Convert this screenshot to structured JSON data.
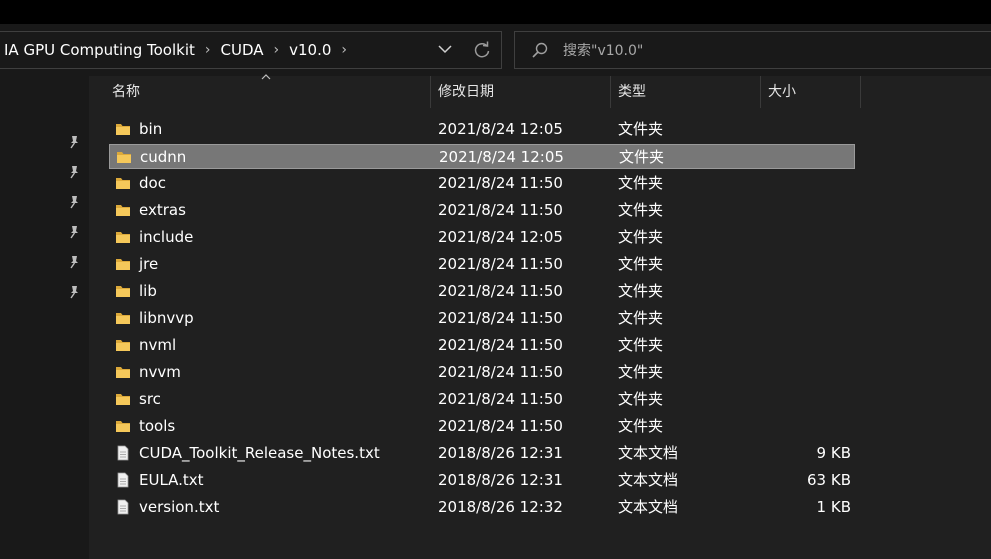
{
  "address_bar": {
    "breadcrumbs": [
      "IA GPU Computing Toolkit",
      "CUDA",
      "v10.0"
    ]
  },
  "search": {
    "placeholder": "搜索\"v10.0\""
  },
  "columns": {
    "name": "名称",
    "date": "修改日期",
    "type": "类型",
    "size": "大小"
  },
  "files": [
    {
      "name": "bin",
      "date": "2021/8/24 12:05",
      "type": "文件夹",
      "size": "",
      "icon": "folder-icon"
    },
    {
      "name": "cudnn",
      "date": "2021/8/24 12:05",
      "type": "文件夹",
      "size": "",
      "icon": "folder-icon",
      "selected": true
    },
    {
      "name": "doc",
      "date": "2021/8/24 11:50",
      "type": "文件夹",
      "size": "",
      "icon": "folder-icon"
    },
    {
      "name": "extras",
      "date": "2021/8/24 11:50",
      "type": "文件夹",
      "size": "",
      "icon": "folder-icon"
    },
    {
      "name": "include",
      "date": "2021/8/24 12:05",
      "type": "文件夹",
      "size": "",
      "icon": "folder-icon"
    },
    {
      "name": "jre",
      "date": "2021/8/24 11:50",
      "type": "文件夹",
      "size": "",
      "icon": "folder-icon"
    },
    {
      "name": "lib",
      "date": "2021/8/24 11:50",
      "type": "文件夹",
      "size": "",
      "icon": "folder-icon"
    },
    {
      "name": "libnvvp",
      "date": "2021/8/24 11:50",
      "type": "文件夹",
      "size": "",
      "icon": "folder-icon"
    },
    {
      "name": "nvml",
      "date": "2021/8/24 11:50",
      "type": "文件夹",
      "size": "",
      "icon": "folder-icon"
    },
    {
      "name": "nvvm",
      "date": "2021/8/24 11:50",
      "type": "文件夹",
      "size": "",
      "icon": "folder-icon"
    },
    {
      "name": "src",
      "date": "2021/8/24 11:50",
      "type": "文件夹",
      "size": "",
      "icon": "folder-icon"
    },
    {
      "name": "tools",
      "date": "2021/8/24 11:50",
      "type": "文件夹",
      "size": "",
      "icon": "folder-icon"
    },
    {
      "name": "CUDA_Toolkit_Release_Notes.txt",
      "date": "2018/8/26 12:31",
      "type": "文本文档",
      "size": "9 KB",
      "icon": "text-file-icon"
    },
    {
      "name": "EULA.txt",
      "date": "2018/8/26 12:31",
      "type": "文本文档",
      "size": "63 KB",
      "icon": "text-file-icon"
    },
    {
      "name": "version.txt",
      "date": "2018/8/26 12:32",
      "type": "文本文档",
      "size": "1 KB",
      "icon": "text-file-icon"
    }
  ],
  "quick_access_pins": 6,
  "colors": {
    "background": "#191919",
    "list_background": "#202020",
    "selected_row": "#777777",
    "folder": "#f5c85a"
  }
}
